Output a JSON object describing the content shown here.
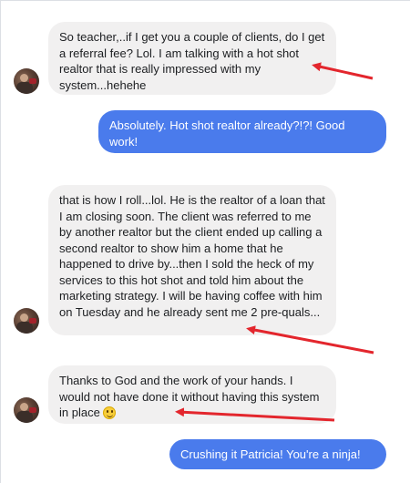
{
  "messages": [
    {
      "side": "incoming",
      "text": "So teacher,..if I get you a couple of clients, do I get a referral fee? Lol. I am talking with a hot shot realtor that is really impressed with my system...hehehe"
    },
    {
      "side": "outgoing",
      "text": "Absolutely.  Hot shot realtor already?!?!  Good work!"
    },
    {
      "side": "incoming",
      "text": "that is how I roll...lol. He is the realtor of a loan that I am closing soon. The client was referred to me by another realtor but the client ended up calling a second realtor to show him  a home that he happened to drive by...then I sold the heck of my services to this hot shot and told him about the marketing strategy. I will be having coffee with him on Tuesday and he already sent me 2 pre-quals..."
    },
    {
      "side": "incoming",
      "text": "Thanks to God and the work of your hands. I would not have done it without having this system in place",
      "emoji": "smiling-face"
    },
    {
      "side": "outgoing",
      "text": "Crushing it Patricia!  You're a ninja!"
    }
  ],
  "colors": {
    "incoming_bubble": "#f1f0f0",
    "outgoing_bubble": "#4a7bec",
    "annotation_arrow": "#e3262d"
  }
}
